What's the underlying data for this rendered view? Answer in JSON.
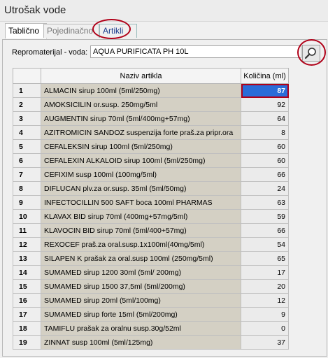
{
  "window": {
    "title": "Utrošak vode"
  },
  "tabs": [
    {
      "label": "Tablično"
    },
    {
      "label": "Pojedinačno"
    },
    {
      "label": "Artikli"
    }
  ],
  "repro": {
    "label": "Repromaterijal - voda:",
    "value": "AQUA PURIFICATA PH 10L"
  },
  "grid": {
    "headers": {
      "num": "",
      "name": "Naziv artikla",
      "qty": "Količina (ml)"
    },
    "rows": [
      {
        "num": "1",
        "name": "ALMACIN sirup 100ml (5ml/250mg)",
        "qty": "87"
      },
      {
        "num": "2",
        "name": "AMOKSICILIN or.susp. 250mg/5ml",
        "qty": "92"
      },
      {
        "num": "3",
        "name": "AUGMENTIN sirup 70ml (5ml/400mg+57mg)",
        "qty": "64"
      },
      {
        "num": "4",
        "name": "AZITROMICIN SANDOZ suspenzija forte praš.za pripr.ora",
        "qty": "8"
      },
      {
        "num": "5",
        "name": "CEFALEKSIN sirup 100ml (5ml/250mg)",
        "qty": "60"
      },
      {
        "num": "6",
        "name": "CEFALEXIN ALKALOID sirup 100ml (5ml/250mg)",
        "qty": "60"
      },
      {
        "num": "7",
        "name": "CEFIXIM susp 100ml (100mg/5ml)",
        "qty": "66"
      },
      {
        "num": "8",
        "name": "DIFLUCAN plv.za or.susp. 35ml (5ml/50mg)",
        "qty": "24"
      },
      {
        "num": "9",
        "name": "INFECTOCILLIN 500 SAFT boca 100ml PHARMAS",
        "qty": "63"
      },
      {
        "num": "10",
        "name": "KLAVAX BID sirup 70ml (400mg+57mg/5ml)",
        "qty": "59"
      },
      {
        "num": "11",
        "name": "KLAVOCIN BID sirup 70ml (5ml/400+57mg)",
        "qty": "66"
      },
      {
        "num": "12",
        "name": "REXOCEF praš.za oral.susp.1x100ml(40mg/5ml)",
        "qty": "54"
      },
      {
        "num": "13",
        "name": "SILAPEN K prašak za oral.susp 100ml (250mg/5ml)",
        "qty": "65"
      },
      {
        "num": "14",
        "name": "SUMAMED sirup 1200 30ml (5ml/ 200mg)",
        "qty": "17"
      },
      {
        "num": "15",
        "name": "SUMAMED sirup 1500 37,5ml (5ml/200mg)",
        "qty": "20"
      },
      {
        "num": "16",
        "name": "SUMAMED sirup 20ml (5ml/100mg)",
        "qty": "12"
      },
      {
        "num": "17",
        "name": "SUMAMED sirup forte 15ml (5ml/200mg)",
        "qty": "9"
      },
      {
        "num": "18",
        "name": "TAMIFLU prašak za oralnu susp.30g/52ml",
        "qty": "0"
      },
      {
        "num": "19",
        "name": "ZINNAT susp 100ml (5ml/125mg)",
        "qty": "37"
      }
    ]
  },
  "icons": {
    "search": "magnifier-icon"
  },
  "colors": {
    "selection": "#2a6cd8",
    "highlight_ring": "#b00018"
  }
}
